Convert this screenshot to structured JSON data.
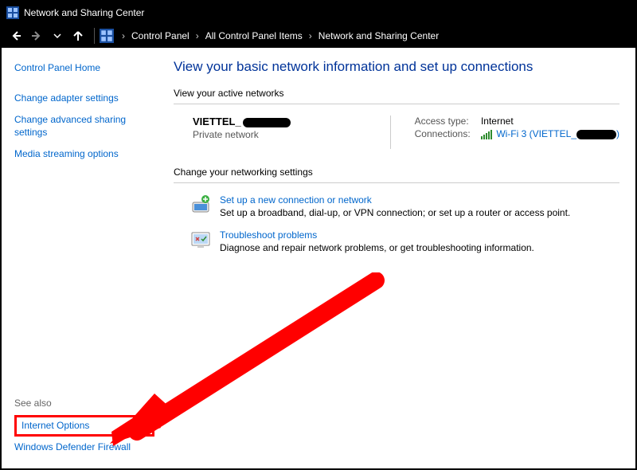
{
  "titlebar": {
    "title": "Network and Sharing Center"
  },
  "breadcrumb": {
    "items": [
      "Control Panel",
      "All Control Panel Items",
      "Network and Sharing Center"
    ]
  },
  "sidebar": {
    "home": "Control Panel Home",
    "links": {
      "adapter": "Change adapter settings",
      "advanced": "Change advanced sharing settings",
      "media": "Media streaming options"
    },
    "see_also_label": "See also",
    "see_also": {
      "internet_options": "Internet Options",
      "firewall": "Windows Defender Firewall"
    }
  },
  "main": {
    "heading": "View your basic network information and set up connections",
    "active_networks_title": "View your active networks",
    "network": {
      "name_prefix": "VIETTEL_",
      "type": "Private network",
      "access_label": "Access type:",
      "access_value": "Internet",
      "conn_label": "Connections:",
      "conn_link_prefix": "Wi-Fi 3 (VIETTEL_",
      "conn_link_suffix": ")"
    },
    "change_title": "Change your networking settings",
    "opt_setup": {
      "title": "Set up a new connection or network",
      "desc": "Set up a broadband, dial-up, or VPN connection; or set up a router or access point."
    },
    "opt_troubleshoot": {
      "title": "Troubleshoot problems",
      "desc": "Diagnose and repair network problems, or get troubleshooting information."
    }
  }
}
